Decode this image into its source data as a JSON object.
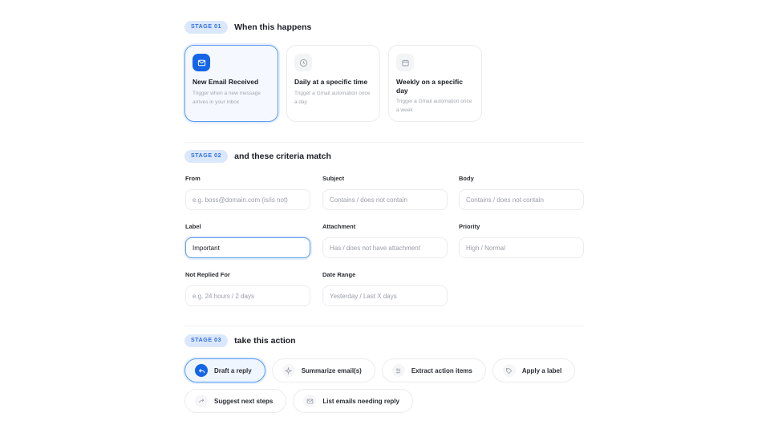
{
  "stage1": {
    "badge": "STAGE 01",
    "title": "When this happens",
    "triggers": [
      {
        "title": "New Email Received",
        "desc": "Trigger when a new message arrives in your inbox",
        "icon": "mail-icon",
        "selected": true
      },
      {
        "title": "Daily at a specific time",
        "desc": "Trigger a Gmail automation once a day",
        "icon": "clock-icon",
        "selected": false
      },
      {
        "title": "Weekly on a specific day",
        "desc": "Trigger a Gmail automation once a week",
        "icon": "calendar-icon",
        "selected": false
      }
    ]
  },
  "stage2": {
    "badge": "STAGE 02",
    "title": "and these criteria match",
    "fields": {
      "from": {
        "label": "From",
        "placeholder": "e.g. boss@domain.com (is/is not)",
        "value": ""
      },
      "subject": {
        "label": "Subject",
        "placeholder": "Contains / does not contain",
        "value": ""
      },
      "body": {
        "label": "Body",
        "placeholder": "Contains / does not contain",
        "value": ""
      },
      "label": {
        "label": "Label",
        "placeholder": "",
        "value": "Important"
      },
      "attachment": {
        "label": "Attachment",
        "placeholder": "Has / does not have attachment",
        "value": ""
      },
      "priority": {
        "label": "Priority",
        "placeholder": "High / Normal",
        "value": ""
      },
      "not_replied": {
        "label": "Not Replied For",
        "placeholder": "e.g. 24 hours / 2 days",
        "value": ""
      },
      "date_range": {
        "label": "Date Range",
        "placeholder": "Yesterday / Last X days",
        "value": ""
      }
    }
  },
  "stage3": {
    "badge": "STAGE 03",
    "title": "take this action",
    "actions": [
      {
        "label": "Draft a reply",
        "icon": "reply-icon",
        "selected": true
      },
      {
        "label": "Summarize email(s)",
        "icon": "sparkle-icon",
        "selected": false
      },
      {
        "label": "Extract action items",
        "icon": "list-icon",
        "selected": false
      },
      {
        "label": "Apply a label",
        "icon": "tag-icon",
        "selected": false
      },
      {
        "label": "Suggest next steps",
        "icon": "arrow-right-icon",
        "selected": false
      },
      {
        "label": "List emails needing reply",
        "icon": "mail-icon",
        "selected": false
      }
    ]
  },
  "colors": {
    "accent": "#1565e6",
    "accent_border": "#5b9cf0",
    "badge_bg": "#dbe7fb"
  }
}
